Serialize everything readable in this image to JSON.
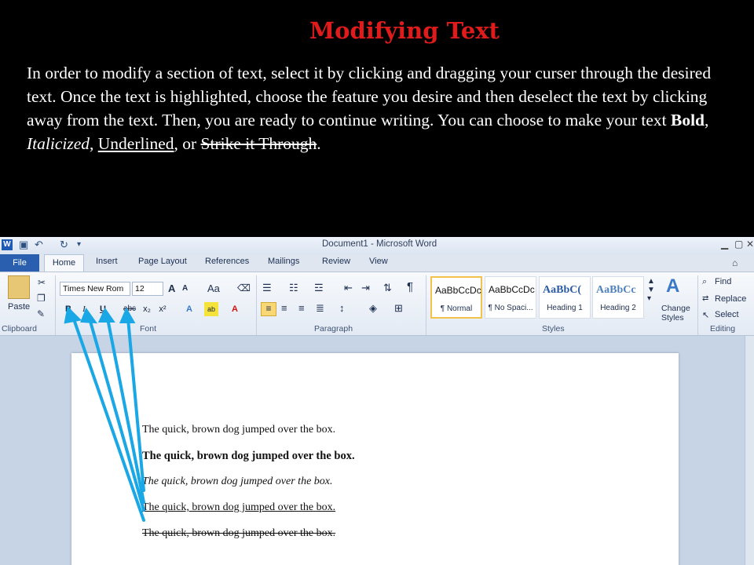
{
  "slide": {
    "title": "Modifying Text",
    "body_intro": "In order to modify a section of text, select it by clicking and dragging your curser through the desired text.  Once the text is highlighted, choose the feature you desire and then deselect the text by clicking away from the text.  Then, you are ready to continue writing.  You can choose to make your text ",
    "bold_word": "Bold",
    "italic_word": "Italicized",
    "underline_word": "Underlined",
    "sep1": ", ",
    "sep2": ", ",
    "sep3": ", or ",
    "strike_word": "Strike it Through",
    "end": "."
  },
  "word": {
    "app_icon": "W",
    "title": "Document1  -  Microsoft Word",
    "tabs": [
      "File",
      "Home",
      "Insert",
      "Page Layout",
      "References",
      "Mailings",
      "Review",
      "View"
    ],
    "clipboard": {
      "paste_label": "Paste",
      "group_label": "Clipboard"
    },
    "font": {
      "font_name": "Times New Rom",
      "font_size": "12",
      "grow_label": "A",
      "change_case_label": "Aa",
      "bold_label": "B",
      "italic_label": "I",
      "underline_label": "U",
      "strike_label": "abc",
      "subscript_label": "x₂",
      "superscript_label": "x²",
      "group_label": "Font"
    },
    "paragraph": {
      "group_label": "Paragraph"
    },
    "styles": {
      "cards": [
        {
          "sample": "AaBbCcDc",
          "name": "¶ Normal"
        },
        {
          "sample": "AaBbCcDc",
          "name": "¶ No Spaci..."
        },
        {
          "sample": "AaBbC(",
          "name": "Heading 1"
        },
        {
          "sample": "AaBbCc",
          "name": "Heading 2"
        }
      ],
      "change_styles_label": "Change Styles",
      "group_label": "Styles"
    },
    "editing": {
      "find": "Find",
      "replace": "Replace",
      "select": "Select",
      "group_label": "Editing"
    },
    "document_lines": [
      "The quick, brown dog jumped over the box.",
      "The quick, brown dog jumped over the box.",
      "The quick, brown dog jumped over the box.",
      "The quick, brown dog jumped over the box.",
      "The quick, brown dog jumped over the box."
    ]
  },
  "colors": {
    "title": "#e01b1b",
    "arrow": "#1aa7e6",
    "file_tab": "#2a5fb0"
  }
}
